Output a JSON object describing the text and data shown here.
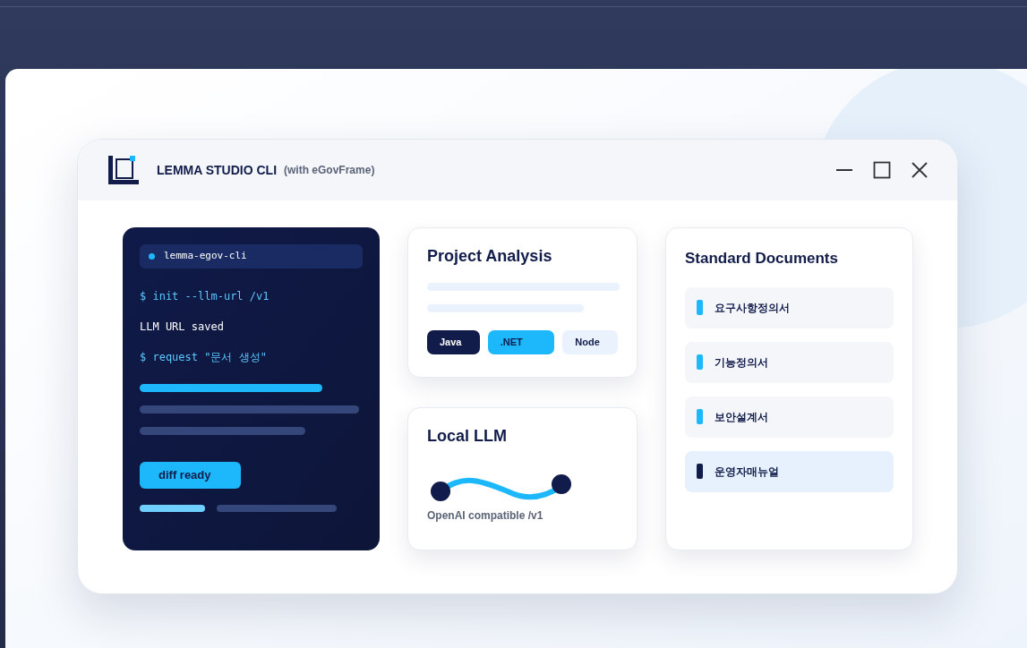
{
  "window": {
    "title": "LEMMA STUDIO CLI",
    "subtitle": "(with eGovFrame)"
  },
  "terminal": {
    "tab": "lemma-egov-cli",
    "lines": [
      {
        "kind": "command",
        "text": "$ init --llm-url /v1"
      },
      {
        "kind": "output",
        "text": "LLM URL saved"
      },
      {
        "kind": "command",
        "text": "$ request \"문서 생성\""
      }
    ],
    "status": "diff ready"
  },
  "project_analysis": {
    "title": "Project Analysis",
    "tags": [
      {
        "label": "Java",
        "kind": "dark"
      },
      {
        "label": ".NET",
        "kind": "accent"
      },
      {
        "label": "Node",
        "kind": "light"
      }
    ]
  },
  "local_llm": {
    "title": "Local LLM",
    "caption": "OpenAI compatible /v1"
  },
  "standard_documents": {
    "title": "Standard Documents",
    "items": [
      {
        "label": "요구사항정의서",
        "selected": false
      },
      {
        "label": "기능정의서",
        "selected": false
      },
      {
        "label": "보안설계서",
        "selected": false
      },
      {
        "label": "운영자매뉴얼",
        "selected": true
      }
    ]
  }
}
